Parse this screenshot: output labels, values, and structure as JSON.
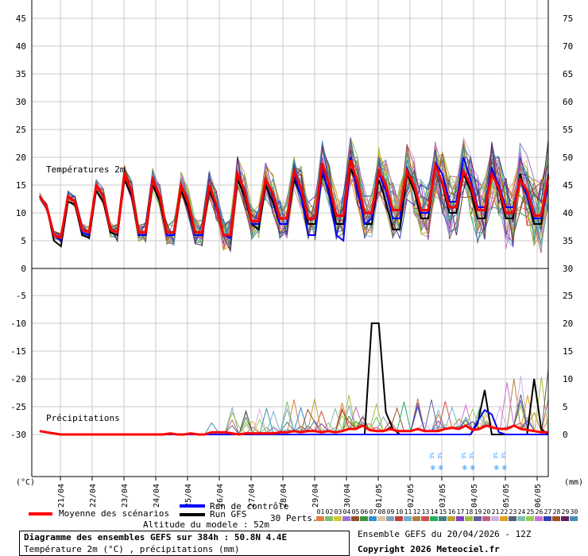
{
  "chart_data": {
    "type": "line",
    "temp_panel": {
      "label": "Températures 2m",
      "y_left_ticks": [
        45,
        40,
        35,
        30,
        25,
        20,
        15,
        10,
        5,
        0
      ],
      "y_right_ticks": [
        75,
        70,
        65,
        60,
        55,
        50,
        45,
        40,
        35,
        30
      ],
      "ylim": [
        0,
        48
      ]
    },
    "precip_panel": {
      "label": "Précipitations",
      "y_left_ticks": [
        -5,
        -10,
        -15,
        -20,
        -25,
        -30
      ],
      "y_right_ticks": [
        25,
        20,
        15,
        10,
        5,
        0
      ],
      "ylim": [
        0,
        25
      ]
    },
    "left_unit": "(°C)",
    "right_unit": "(mm)",
    "x_labels": [
      "21/04",
      "22/04",
      "23/04",
      "24/04",
      "25/04",
      "26/04",
      "27/04",
      "28/04",
      "29/04",
      "30/04",
      "01/05",
      "02/05",
      "03/05",
      "04/05",
      "05/05",
      "06/05"
    ],
    "snow_text": "3%",
    "snow_dates": [
      "03/05",
      "04/05",
      "05/05"
    ],
    "series": [
      {
        "name": "Moyenne des scénarios",
        "color": "#ff0000",
        "temp": [
          13,
          11,
          6,
          5.5,
          13,
          12,
          7,
          6.5,
          15,
          13,
          7,
          6.5,
          17,
          14,
          6.5,
          6.5,
          16,
          13,
          6.5,
          6.5,
          15,
          12,
          6.5,
          6.5,
          15,
          11.5,
          6,
          6,
          17,
          14,
          8.5,
          8.5,
          16,
          13.5,
          9,
          9,
          17.5,
          14.5,
          9,
          9,
          19,
          15,
          9.5,
          9.5,
          19.5,
          15.5,
          10,
          10,
          17.5,
          15,
          10.5,
          10.5,
          17.5,
          15,
          10.5,
          10.5,
          18.5,
          15.5,
          11,
          11,
          17.5,
          15,
          10.5,
          10.5,
          17,
          14.5,
          10,
          10,
          16,
          14,
          9.5,
          9.5,
          16.5
        ],
        "precip": [
          0.3,
          0.2,
          0.1,
          0,
          0,
          0,
          0,
          0,
          0,
          0,
          0,
          0,
          0,
          0,
          0,
          0,
          0,
          0,
          0,
          0.1,
          0,
          0,
          0.1,
          0,
          0,
          0.2,
          0.2,
          0.2,
          0.1,
          0,
          0.1,
          0.1,
          0.1,
          0.1,
          0.1,
          0.2,
          0.2,
          0.3,
          0.2,
          0.3,
          0.3,
          0.2,
          0.3,
          0.2,
          0.3,
          0.5,
          0.5,
          0.8,
          0.4,
          0.3,
          0.3,
          0.5,
          0.3,
          0.3,
          0.3,
          0.5,
          0.3,
          0.3,
          0.3,
          0.5,
          0.6,
          0.5,
          0.8,
          0.4,
          0.5,
          0.8,
          0.6,
          0.5,
          0.5,
          0.8,
          0.5,
          0.4,
          0.3,
          0.2,
          0.2
        ]
      },
      {
        "name": "Run de contrôle",
        "color": "#0000ff",
        "temp": [
          13,
          11,
          6,
          5,
          13,
          12,
          6.5,
          6,
          15,
          13,
          7,
          6.5,
          17,
          14,
          6,
          6,
          16,
          13,
          6,
          6,
          15,
          12,
          6,
          6,
          15,
          11,
          6,
          5.5,
          17,
          14,
          8,
          8,
          16,
          13,
          8,
          8,
          17,
          13,
          6,
          6,
          18,
          13,
          6,
          5,
          20,
          14,
          8,
          9,
          17,
          14,
          9,
          9,
          18,
          15,
          10,
          10,
          19,
          17,
          12,
          12,
          20,
          16,
          11,
          11,
          18,
          15,
          11,
          11,
          16,
          13,
          9,
          9,
          15
        ],
        "precip": [
          0.3,
          0.2,
          0.1,
          0,
          0,
          0,
          0,
          0,
          0,
          0,
          0,
          0,
          0,
          0,
          0,
          0,
          0,
          0,
          0,
          0,
          0,
          0,
          0,
          0,
          0,
          0,
          0,
          0,
          0,
          0,
          0,
          0,
          0,
          0,
          0,
          0,
          0,
          0,
          0,
          0,
          0,
          0,
          0,
          0,
          0,
          0,
          0,
          0,
          0,
          0,
          0,
          0,
          0,
          0,
          0,
          0,
          0,
          0,
          0,
          0,
          0,
          0,
          1.2,
          2.2,
          1.8,
          0.2,
          0,
          0,
          0,
          0,
          0,
          0,
          0
        ]
      },
      {
        "name": "Run GFS",
        "color": "#000000",
        "temp": [
          13,
          11,
          5,
          4,
          12,
          11.5,
          6,
          5.5,
          14,
          12,
          6.5,
          6,
          16,
          13,
          6,
          6,
          15,
          12,
          6,
          6,
          14,
          11,
          6,
          6,
          14,
          11,
          6,
          5.5,
          16,
          13,
          8,
          7,
          15,
          12,
          8,
          8,
          16,
          13,
          8,
          8,
          17,
          14,
          8,
          8,
          18,
          15,
          8,
          8,
          16,
          12,
          7,
          7,
          17,
          14,
          9,
          9,
          19,
          15,
          10,
          10,
          17,
          14,
          9,
          9,
          18,
          14,
          9,
          9,
          17,
          13,
          8,
          8,
          17
        ],
        "precip": [
          0.3,
          0.2,
          0.1,
          0,
          0,
          0,
          0,
          0,
          0,
          0,
          0,
          0,
          0,
          0,
          0,
          0,
          0,
          0,
          0,
          0,
          0,
          0,
          0,
          0,
          0,
          0,
          0,
          0,
          0,
          0,
          0,
          0,
          0,
          0,
          0,
          0,
          0,
          0,
          0,
          0,
          0,
          0,
          0,
          0,
          0,
          0,
          0,
          10,
          10,
          2,
          0.5,
          0,
          0,
          0,
          0,
          0,
          0,
          0,
          0,
          0,
          0,
          0,
          1,
          4,
          0,
          0,
          0,
          0,
          0,
          0,
          5,
          0.5,
          0
        ]
      }
    ],
    "perturbations": {
      "label": "30 Perts.",
      "ids": [
        "01",
        "02",
        "03",
        "04",
        "05",
        "06",
        "07",
        "08",
        "09",
        "10",
        "11",
        "12",
        "13",
        "14",
        "15",
        "16",
        "17",
        "18",
        "19",
        "20",
        "21",
        "22",
        "23",
        "24",
        "25",
        "26",
        "27",
        "28",
        "29",
        "30"
      ],
      "colors": [
        "#e0803c",
        "#7cc06e",
        "#d4c834",
        "#a070d0",
        "#905028",
        "#409040",
        "#3090d0",
        "#e0c0a0",
        "#80a0c0",
        "#c04040",
        "#70b0d0",
        "#b08040",
        "#d05050",
        "#20b060",
        "#408080",
        "#c0a030",
        "#8040c0",
        "#a0c040",
        "#6060a0",
        "#c06080",
        "#d0b0e0",
        "#e0a020",
        "#506070",
        "#80c0b0",
        "#90d050",
        "#d070d0",
        "#3040b0",
        "#a05020",
        "#602060",
        "#4090b0"
      ]
    }
  },
  "legend": {
    "mean_label": "Moyenne des scénarios",
    "control_label": "Run de contrôle",
    "gfs_label": "Run GFS",
    "altitude": "Altitude du modele : 52m"
  },
  "footer": {
    "title": "Diagramme des ensembles GEFS sur 384h : 50.8N 4.4E",
    "subtitle": "Température 2m (°C) , précipitations (mm)",
    "run_info": "Ensemble GEFS du 20/04/2026 - 12Z",
    "copyright": "Copyright 2026 Meteociel.fr"
  },
  "colors": {
    "mean": "#ff0000",
    "control": "#0000ff",
    "gfs": "#000000",
    "grid": "#c0c0c0",
    "snow": "#3399ff"
  }
}
